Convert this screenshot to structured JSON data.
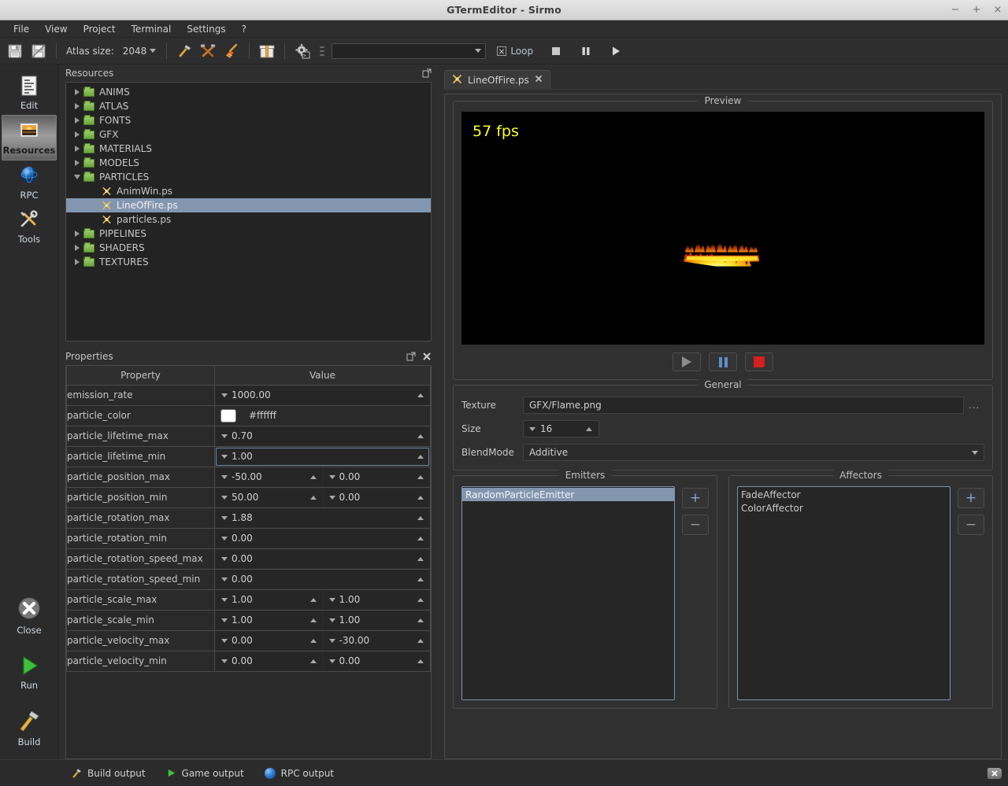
{
  "window": {
    "title": "GTermEditor - Sirmo",
    "minimize": "−",
    "maximize": "+",
    "close": "×"
  },
  "menubar": {
    "items": [
      {
        "label": "File"
      },
      {
        "label": "View"
      },
      {
        "label": "Project"
      },
      {
        "label": "Terminal"
      },
      {
        "label": "Settings"
      },
      {
        "label": "?"
      }
    ]
  },
  "toolbar": {
    "save_icon": "save-icon",
    "save_as_icon": "save-as-icon",
    "atlas_size_label": "Atlas size:",
    "atlas_size_value": "2048",
    "build_icon": "hammer-icon",
    "rebuild_icon": "hammer-and-pick-icon",
    "clean_icon": "broom-icon",
    "package_icon": "package-icon",
    "settings_icon": "gear-terminal-icon",
    "run_config_value": "",
    "loop_label": "Loop",
    "loop_checked": true,
    "stop_icon": "stop-icon",
    "pause_icon": "pause-icon",
    "play_icon": "play-icon"
  },
  "rail": {
    "items": [
      {
        "label": "Edit",
        "icon": "document-lines-icon",
        "active": false
      },
      {
        "label": "Resources",
        "icon": "image-sunset-icon",
        "active": true
      },
      {
        "label": "RPC",
        "icon": "globe-icon",
        "active": false
      },
      {
        "label": "Tools",
        "icon": "screwdriver-wrench-icon",
        "active": false
      }
    ],
    "bottom": [
      {
        "label": "Close",
        "icon": "close-circle-icon"
      },
      {
        "label": "Run",
        "icon": "play-triangle-icon"
      },
      {
        "label": "Build",
        "icon": "hammer-icon"
      }
    ]
  },
  "resources": {
    "title": "Resources",
    "popout_icon": "popout-icon",
    "tree": [
      {
        "label": "ANIMS",
        "type": "folder",
        "expanded": false,
        "depth": 0,
        "selected": false
      },
      {
        "label": "ATLAS",
        "type": "folder",
        "expanded": false,
        "depth": 0,
        "selected": false
      },
      {
        "label": "FONTS",
        "type": "folder",
        "expanded": false,
        "depth": 0,
        "selected": false
      },
      {
        "label": "GFX",
        "type": "folder",
        "expanded": false,
        "depth": 0,
        "selected": false
      },
      {
        "label": "MATERIALS",
        "type": "folder",
        "expanded": false,
        "depth": 0,
        "selected": false
      },
      {
        "label": "MODELS",
        "type": "folder",
        "expanded": false,
        "depth": 0,
        "selected": false
      },
      {
        "label": "PARTICLES",
        "type": "folder",
        "expanded": true,
        "depth": 0,
        "selected": false
      },
      {
        "label": "AnimWin.ps",
        "type": "ps",
        "expanded": null,
        "depth": 1,
        "selected": false
      },
      {
        "label": "LineOfFire.ps",
        "type": "ps",
        "expanded": null,
        "depth": 1,
        "selected": true
      },
      {
        "label": "particles.ps",
        "type": "ps",
        "expanded": null,
        "depth": 1,
        "selected": false
      },
      {
        "label": "PIPELINES",
        "type": "folder",
        "expanded": false,
        "depth": 0,
        "selected": false
      },
      {
        "label": "SHADERS",
        "type": "folder",
        "expanded": false,
        "depth": 0,
        "selected": false
      },
      {
        "label": "TEXTURES",
        "type": "folder",
        "expanded": false,
        "depth": 0,
        "selected": false
      }
    ]
  },
  "properties": {
    "title": "Properties",
    "popout_icon": "popout-icon",
    "close_icon": "close-icon",
    "columns": [
      "Property",
      "Value"
    ],
    "rows": [
      {
        "name": "emission_rate",
        "kind": "spin",
        "v1": "1000.00",
        "v2": null,
        "focus": false
      },
      {
        "name": "particle_color",
        "kind": "color",
        "v1": "#ffffff",
        "v2": null,
        "focus": false
      },
      {
        "name": "particle_lifetime_max",
        "kind": "spin",
        "v1": "0.70",
        "v2": null,
        "focus": false
      },
      {
        "name": "particle_lifetime_min",
        "kind": "spin",
        "v1": "1.00",
        "v2": null,
        "focus": true
      },
      {
        "name": "particle_position_max",
        "kind": "spin2",
        "v1": "-50.00",
        "v2": "0.00",
        "focus": false
      },
      {
        "name": "particle_position_min",
        "kind": "spin2",
        "v1": "50.00",
        "v2": "0.00",
        "focus": false
      },
      {
        "name": "particle_rotation_max",
        "kind": "spin",
        "v1": "1.88",
        "v2": null,
        "focus": false
      },
      {
        "name": "particle_rotation_min",
        "kind": "spin",
        "v1": "0.00",
        "v2": null,
        "focus": false
      },
      {
        "name": "particle_rotation_speed_max",
        "kind": "spin",
        "v1": "0.00",
        "v2": null,
        "focus": false
      },
      {
        "name": "particle_rotation_speed_min",
        "kind": "spin",
        "v1": "0.00",
        "v2": null,
        "focus": false
      },
      {
        "name": "particle_scale_max",
        "kind": "spin2",
        "v1": "1.00",
        "v2": "1.00",
        "focus": false
      },
      {
        "name": "particle_scale_min",
        "kind": "spin2",
        "v1": "1.00",
        "v2": "1.00",
        "focus": false
      },
      {
        "name": "particle_velocity_max",
        "kind": "spin2",
        "v1": "0.00",
        "v2": "-30.00",
        "focus": false
      },
      {
        "name": "particle_velocity_min",
        "kind": "spin2",
        "v1": "0.00",
        "v2": "0.00",
        "focus": false
      }
    ]
  },
  "editor": {
    "tab": {
      "label": "LineOfFire.ps",
      "icon": "particle-icon",
      "close_icon": "close-icon"
    },
    "preview": {
      "legend": "Preview",
      "fps": "57 fps",
      "controls": {
        "play": "play-icon",
        "pause": "pause-icon",
        "stop": "stop-icon"
      }
    },
    "general": {
      "legend": "General",
      "texture_label": "Texture",
      "texture_value": "GFX/Flame.png",
      "browse_label": "...",
      "size_label": "Size",
      "size_value": "16",
      "blendmode_label": "BlendMode",
      "blendmode_value": "Additive"
    },
    "emitters": {
      "legend": "Emitters",
      "items": [
        {
          "label": "RandomParticleEmitter",
          "selected": true
        }
      ],
      "add_label": "+",
      "remove_label": "−"
    },
    "affectors": {
      "legend": "Affectors",
      "items": [
        {
          "label": "FadeAffector",
          "selected": false
        },
        {
          "label": "ColorAffector",
          "selected": false
        }
      ],
      "add_label": "+",
      "remove_label": "−"
    }
  },
  "statusbar": {
    "items": [
      {
        "label": "Build output",
        "icon": "hammer-icon"
      },
      {
        "label": "Game output",
        "icon": "play-triangle-icon"
      },
      {
        "label": "RPC output",
        "icon": "globe-icon"
      }
    ],
    "close_icon": "close-tag-icon"
  },
  "colors": {
    "selection": "#8396b0",
    "accent_blue": "#7fa7d6",
    "fps_yellow": "#ffff2a",
    "stop_red": "#d42020",
    "folder_green": "#6aa63c"
  }
}
